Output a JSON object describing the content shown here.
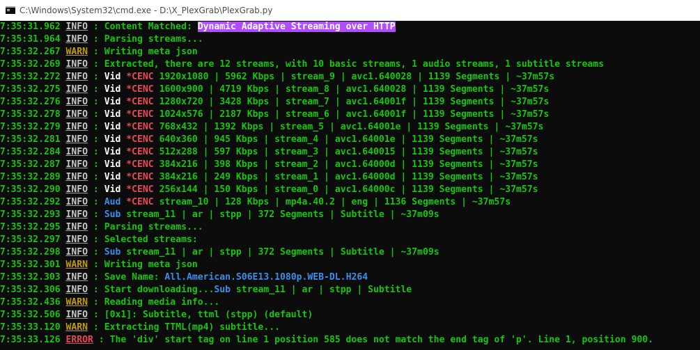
{
  "window": {
    "title": "C:\\Windows\\System32\\cmd.exe - D:\\X_PlexGrab\\PlexGrab.py"
  },
  "colors": {
    "background": "#0c0c0c",
    "green": "#16c60c",
    "info": "#c7c7c7",
    "warn": "#c19c00",
    "error": "#e74856",
    "blue": "#3b8eea",
    "magenta_highlight": "#b14cff"
  },
  "lines": [
    {
      "ts": "07:35:31.962",
      "level": "INFO",
      "parts": [
        {
          "t": "Content Matched: ",
          "c": "msg"
        },
        {
          "t": "Dynamic Adaptive Streaming over HTTP",
          "c": "hl-magenta"
        }
      ]
    },
    {
      "ts": "07:35:31.964",
      "level": "INFO",
      "parts": [
        {
          "t": "Parsing streams...",
          "c": "msg"
        }
      ]
    },
    {
      "ts": "07:35:32.267",
      "level": "WARN",
      "parts": [
        {
          "t": "Writing meta json",
          "c": "msg"
        }
      ]
    },
    {
      "ts": "07:35:32.269",
      "level": "INFO",
      "parts": [
        {
          "t": "Extracted, there are 12 streams, with 10 basic streams, 1 audio streams, 1 subtitle streams",
          "c": "msg"
        }
      ]
    },
    {
      "ts": "07:35:32.272",
      "level": "INFO",
      "parts": [
        {
          "t": "Vid ",
          "c": "kind-vid"
        },
        {
          "t": "*CENC ",
          "c": "cenc"
        },
        {
          "t": "1920x1080 | 5962 Kbps | stream_9 | avc1.640028 | 1139 Segments | ~37m57s",
          "c": "msg"
        }
      ]
    },
    {
      "ts": "07:35:32.275",
      "level": "INFO",
      "parts": [
        {
          "t": "Vid ",
          "c": "kind-vid"
        },
        {
          "t": "*CENC ",
          "c": "cenc"
        },
        {
          "t": "1600x900 | 4719 Kbps | stream_8 | avc1.640028 | 1139 Segments | ~37m57s",
          "c": "msg"
        }
      ]
    },
    {
      "ts": "07:35:32.276",
      "level": "INFO",
      "parts": [
        {
          "t": "Vid ",
          "c": "kind-vid"
        },
        {
          "t": "*CENC ",
          "c": "cenc"
        },
        {
          "t": "1280x720 | 3428 Kbps | stream_7 | avc1.64001f | 1139 Segments | ~37m57s",
          "c": "msg"
        }
      ]
    },
    {
      "ts": "07:35:32.278",
      "level": "INFO",
      "parts": [
        {
          "t": "Vid ",
          "c": "kind-vid"
        },
        {
          "t": "*CENC ",
          "c": "cenc"
        },
        {
          "t": "1024x576 | 2187 Kbps | stream_6 | avc1.64001f | 1139 Segments | ~37m57s",
          "c": "msg"
        }
      ]
    },
    {
      "ts": "07:35:32.279",
      "level": "INFO",
      "parts": [
        {
          "t": "Vid ",
          "c": "kind-vid"
        },
        {
          "t": "*CENC ",
          "c": "cenc"
        },
        {
          "t": "768x432 | 1392 Kbps | stream_5 | avc1.64001e | 1139 Segments | ~37m57s",
          "c": "msg"
        }
      ]
    },
    {
      "ts": "07:35:32.281",
      "level": "INFO",
      "parts": [
        {
          "t": "Vid ",
          "c": "kind-vid"
        },
        {
          "t": "*CENC ",
          "c": "cenc"
        },
        {
          "t": "640x360 | 945 Kbps | stream_4 | avc1.64001e | 1139 Segments | ~37m57s",
          "c": "msg"
        }
      ]
    },
    {
      "ts": "07:35:32.284",
      "level": "INFO",
      "parts": [
        {
          "t": "Vid ",
          "c": "kind-vid"
        },
        {
          "t": "*CENC ",
          "c": "cenc"
        },
        {
          "t": "512x288 | 597 Kbps | stream_3 | avc1.640015 | 1139 Segments | ~37m57s",
          "c": "msg"
        }
      ]
    },
    {
      "ts": "07:35:32.287",
      "level": "INFO",
      "parts": [
        {
          "t": "Vid ",
          "c": "kind-vid"
        },
        {
          "t": "*CENC ",
          "c": "cenc"
        },
        {
          "t": "384x216 | 398 Kbps | stream_2 | avc1.64000d | 1139 Segments | ~37m57s",
          "c": "msg"
        }
      ]
    },
    {
      "ts": "07:35:32.289",
      "level": "INFO",
      "parts": [
        {
          "t": "Vid ",
          "c": "kind-vid"
        },
        {
          "t": "*CENC ",
          "c": "cenc"
        },
        {
          "t": "384x216 | 249 Kbps | stream_1 | avc1.64000d | 1139 Segments | ~37m57s",
          "c": "msg"
        }
      ]
    },
    {
      "ts": "07:35:32.290",
      "level": "INFO",
      "parts": [
        {
          "t": "Vid ",
          "c": "kind-vid"
        },
        {
          "t": "*CENC ",
          "c": "cenc"
        },
        {
          "t": "256x144 | 150 Kbps | stream_0 | avc1.64000c | 1139 Segments | ~37m57s",
          "c": "msg"
        }
      ]
    },
    {
      "ts": "07:35:32.292",
      "level": "INFO",
      "parts": [
        {
          "t": "Aud ",
          "c": "kind-aud"
        },
        {
          "t": "*CENC ",
          "c": "cenc"
        },
        {
          "t": "stream_10 | 128 Kbps | mp4a.40.2 | eng | 1136 Segments | ~37m57s",
          "c": "msg"
        }
      ]
    },
    {
      "ts": "07:35:32.293",
      "level": "INFO",
      "parts": [
        {
          "t": "Sub ",
          "c": "kind-sub"
        },
        {
          "t": "stream_11 | ar | stpp | 372 Segments | Subtitle | ~37m09s",
          "c": "msg"
        }
      ]
    },
    {
      "ts": "07:35:32.295",
      "level": "INFO",
      "parts": [
        {
          "t": "Parsing streams...",
          "c": "msg"
        }
      ]
    },
    {
      "ts": "07:35:32.297",
      "level": "INFO",
      "parts": [
        {
          "t": "Selected streams:",
          "c": "msg"
        }
      ]
    },
    {
      "ts": "07:35:32.298",
      "level": "INFO",
      "parts": [
        {
          "t": "Sub ",
          "c": "kind-sub"
        },
        {
          "t": "stream_11 | ar | stpp | 372 Segments | Subtitle | ~37m09s",
          "c": "msg"
        }
      ]
    },
    {
      "ts": "07:35:32.301",
      "level": "WARN",
      "parts": [
        {
          "t": "Writing meta json",
          "c": "msg"
        }
      ]
    },
    {
      "ts": "07:35:32.303",
      "level": "INFO",
      "parts": [
        {
          "t": "Save Name: ",
          "c": "msg"
        },
        {
          "t": "All.American.S06E13.1080p.WEB-DL.H264",
          "c": "accent-blue"
        }
      ]
    },
    {
      "ts": "07:35:32.306",
      "level": "INFO",
      "parts": [
        {
          "t": "Start downloading...",
          "c": "msg"
        },
        {
          "t": "Sub ",
          "c": "kind-sub"
        },
        {
          "t": "stream_11 | ar | stpp | Subtitle",
          "c": "msg"
        }
      ]
    },
    {
      "ts": "07:35:32.436",
      "level": "WARN",
      "parts": [
        {
          "t": "Reading media info...",
          "c": "msg"
        }
      ]
    },
    {
      "ts": "07:35:32.506",
      "level": "INFO",
      "parts": [
        {
          "t": "[0x1]: Subtitle, ttml (stpp) (default)",
          "c": "msg"
        }
      ]
    },
    {
      "ts": "07:35:33.120",
      "level": "WARN",
      "parts": [
        {
          "t": "Extracting TTML(mp4) subtitle...",
          "c": "msg"
        }
      ]
    },
    {
      "ts": "07:35:33.126",
      "level": "ERROR",
      "parts": [
        {
          "t": "The 'div' start tag on line 1 position 585 does not match the end tag of 'p'. Line 1, position 900.",
          "c": "err-msg"
        }
      ]
    }
  ]
}
